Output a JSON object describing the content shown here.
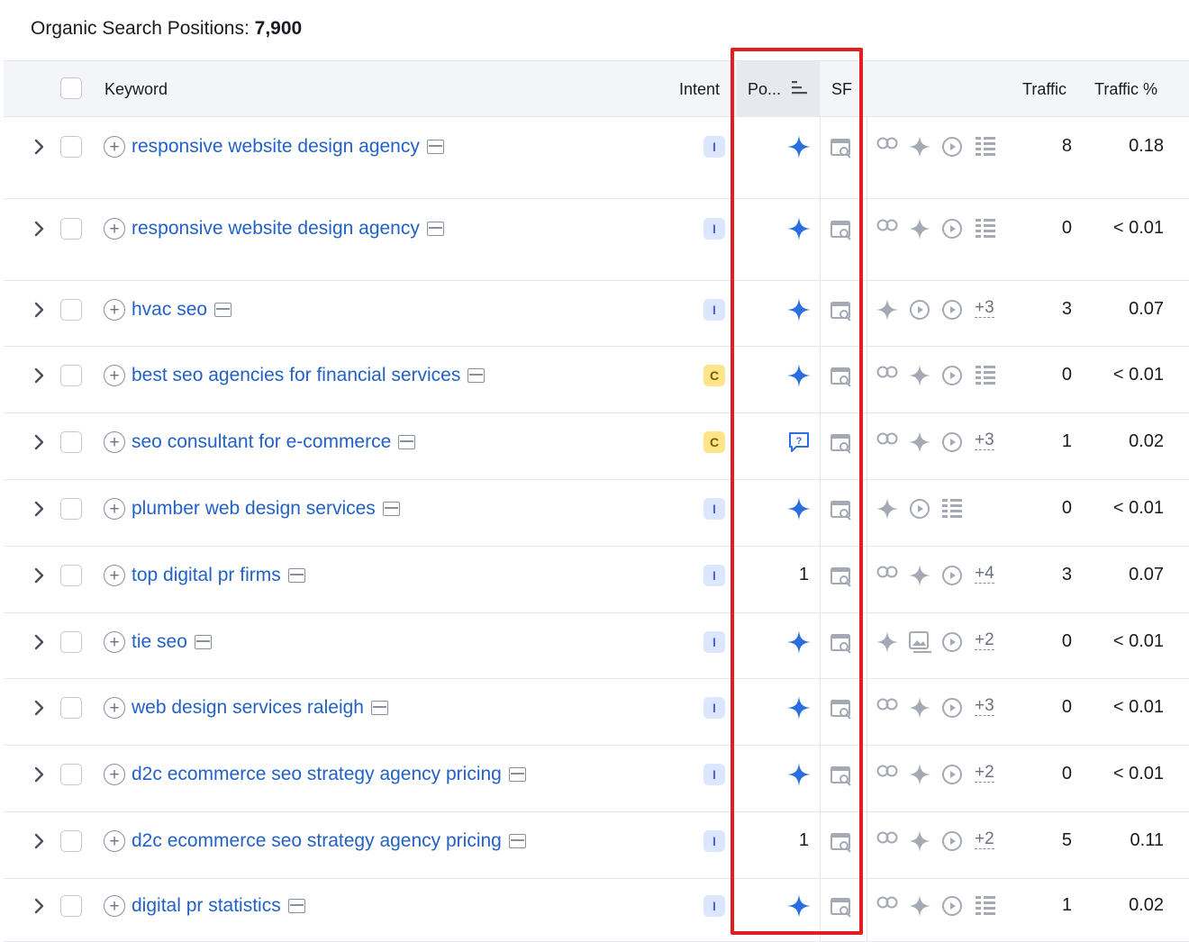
{
  "header": {
    "title_label": "Organic Search Positions:",
    "title_count": "7,900"
  },
  "columns": {
    "keyword": "Keyword",
    "intent": "Intent",
    "position": "Po...",
    "sf": "SF",
    "traffic": "Traffic",
    "traffic_pct": "Traffic %"
  },
  "colors": {
    "link": "#2262c6",
    "highlight": "#e41e20",
    "ai_overview": "#2b6fde",
    "intent_informational_bg": "#dde6ff",
    "intent_commercial_bg": "#ffe58a"
  },
  "rows": [
    {
      "keyword": "responsive website design agency",
      "intent": "I",
      "position": "ai-overview-icon",
      "sf": [
        "link-icon",
        "sparkle-icon",
        "video-icon",
        "list-icon"
      ],
      "traffic": "8",
      "traffic_pct": "0.18"
    },
    {
      "keyword": "responsive website design agency",
      "intent": "I",
      "position": "ai-overview-icon",
      "sf": [
        "link-icon",
        "sparkle-icon",
        "video-icon",
        "list-icon"
      ],
      "traffic": "0",
      "traffic_pct": "< 0.01"
    },
    {
      "keyword": "hvac seo",
      "intent": "I",
      "position": "ai-overview-icon",
      "sf": [
        "sparkle-icon",
        "video-icon",
        "video-icon",
        "+3"
      ],
      "traffic": "3",
      "traffic_pct": "0.07"
    },
    {
      "keyword": "best seo agencies for financial services",
      "intent": "C",
      "position": "ai-overview-icon",
      "sf": [
        "link-icon",
        "sparkle-icon",
        "video-icon",
        "list-icon"
      ],
      "traffic": "0",
      "traffic_pct": "< 0.01"
    },
    {
      "keyword": "seo consultant for e-commerce",
      "intent": "C",
      "position": "question-icon",
      "sf": [
        "link-icon",
        "sparkle-icon",
        "video-icon",
        "+3"
      ],
      "traffic": "1",
      "traffic_pct": "0.02"
    },
    {
      "keyword": "plumber web design services",
      "intent": "I",
      "position": "ai-overview-icon",
      "sf": [
        "sparkle-icon",
        "video-icon",
        "list-icon"
      ],
      "traffic": "0",
      "traffic_pct": "< 0.01"
    },
    {
      "keyword": "top digital pr firms",
      "intent": "I",
      "position": "1",
      "sf": [
        "link-icon",
        "sparkle-icon",
        "video-icon",
        "+4"
      ],
      "traffic": "3",
      "traffic_pct": "0.07"
    },
    {
      "keyword": "tie seo",
      "intent": "I",
      "position": "ai-overview-icon",
      "sf": [
        "sparkle-icon",
        "image-icon",
        "video-icon",
        "+2"
      ],
      "traffic": "0",
      "traffic_pct": "< 0.01"
    },
    {
      "keyword": "web design services raleigh",
      "intent": "I",
      "position": "ai-overview-icon",
      "sf": [
        "link-icon",
        "sparkle-icon",
        "video-icon",
        "+3"
      ],
      "traffic": "0",
      "traffic_pct": "< 0.01"
    },
    {
      "keyword": "d2c ecommerce seo strategy agency pricing",
      "intent": "I",
      "position": "ai-overview-icon",
      "sf": [
        "link-icon",
        "sparkle-icon",
        "video-icon",
        "+2"
      ],
      "traffic": "0",
      "traffic_pct": "< 0.01"
    },
    {
      "keyword": "d2c ecommerce seo strategy agency pricing",
      "intent": "I",
      "position": "1",
      "sf": [
        "link-icon",
        "sparkle-icon",
        "video-icon",
        "+2"
      ],
      "traffic": "5",
      "traffic_pct": "0.11"
    },
    {
      "keyword": "digital pr statistics",
      "intent": "I",
      "position": "ai-overview-icon",
      "sf": [
        "link-icon",
        "sparkle-icon",
        "video-icon",
        "list-icon"
      ],
      "traffic": "1",
      "traffic_pct": "0.02"
    }
  ]
}
